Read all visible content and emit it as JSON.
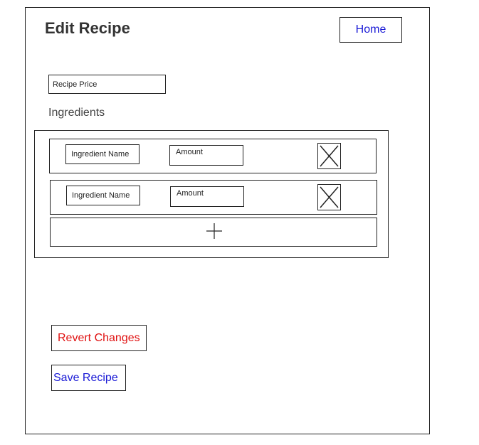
{
  "page": {
    "title": "Edit Recipe"
  },
  "nav": {
    "home_label": "Home"
  },
  "form": {
    "price_placeholder": "Recipe Price",
    "ingredients_label": "Ingredients",
    "ingredients": [
      {
        "name_placeholder": "Ingredient Name",
        "amount_placeholder": "Amount",
        "delete_icon": "x-icon"
      },
      {
        "name_placeholder": "Ingredient Name",
        "amount_placeholder": "Amount",
        "delete_icon": "x-icon"
      }
    ],
    "add_icon": "plus-icon"
  },
  "actions": {
    "revert_label": "Revert Changes",
    "save_label": "Save Recipe"
  },
  "colors": {
    "link_blue": "#1a1ad6",
    "danger_red": "#e01010",
    "border": "#222222"
  }
}
